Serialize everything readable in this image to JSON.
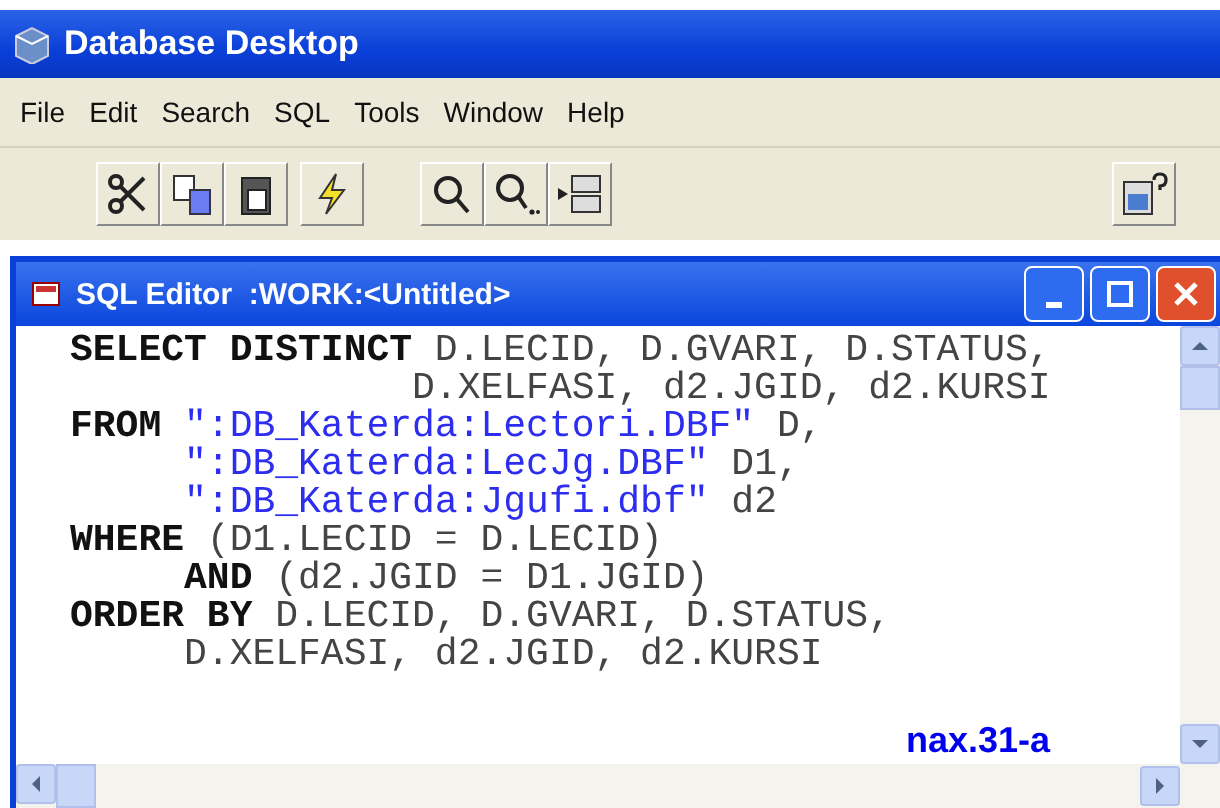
{
  "window": {
    "title": "Database Desktop"
  },
  "menu": [
    "File",
    "Edit",
    "Search",
    "SQL",
    "Tools",
    "Window",
    "Help"
  ],
  "toolbar": [
    {
      "kind": "cut"
    },
    {
      "kind": "copy"
    },
    {
      "kind": "paste"
    },
    {
      "kind": "run"
    },
    {
      "kind": "find"
    },
    {
      "kind": "findnext"
    },
    {
      "kind": "goto"
    },
    {
      "kind": "help"
    }
  ],
  "editor": {
    "title": "SQL Editor  :WORK:<Untitled>",
    "lines": [
      [
        {
          "kind": "keyword",
          "text": "SELECT DISTINCT"
        },
        {
          "kind": "plain",
          "text": " D.LECID, D.GVARI, D.STATUS,"
        }
      ],
      [
        {
          "kind": "plain",
          "text": "               D.XELFASI, d2.JGID, d2.KURSI"
        }
      ],
      [
        {
          "kind": "keyword",
          "text": "FROM"
        },
        {
          "kind": "string",
          "text": " \":DB_Katerda:Lectori.DBF\""
        },
        {
          "kind": "plain",
          "text": " D,"
        }
      ],
      [
        {
          "kind": "string",
          "text": "     \":DB_Katerda:LecJg.DBF\""
        },
        {
          "kind": "plain",
          "text": " D1,"
        }
      ],
      [
        {
          "kind": "string",
          "text": "     \":DB_Katerda:Jgufi.dbf\""
        },
        {
          "kind": "plain",
          "text": " d2"
        }
      ],
      [
        {
          "kind": "keyword",
          "text": "WHERE"
        },
        {
          "kind": "plain",
          "text": " (D1.LECID = D.LECID)"
        }
      ],
      [
        {
          "kind": "keyword",
          "text": "     AND"
        },
        {
          "kind": "plain",
          "text": " (d2.JGID = D1.JGID)"
        }
      ],
      [
        {
          "kind": "keyword",
          "text": "ORDER BY"
        },
        {
          "kind": "plain",
          "text": " D.LECID, D.GVARI, D.STATUS,"
        }
      ],
      [
        {
          "kind": "plain",
          "text": "     D.XELFASI, d2.JGID, d2.KURSI"
        }
      ]
    ]
  },
  "caption": "nax.31-a"
}
